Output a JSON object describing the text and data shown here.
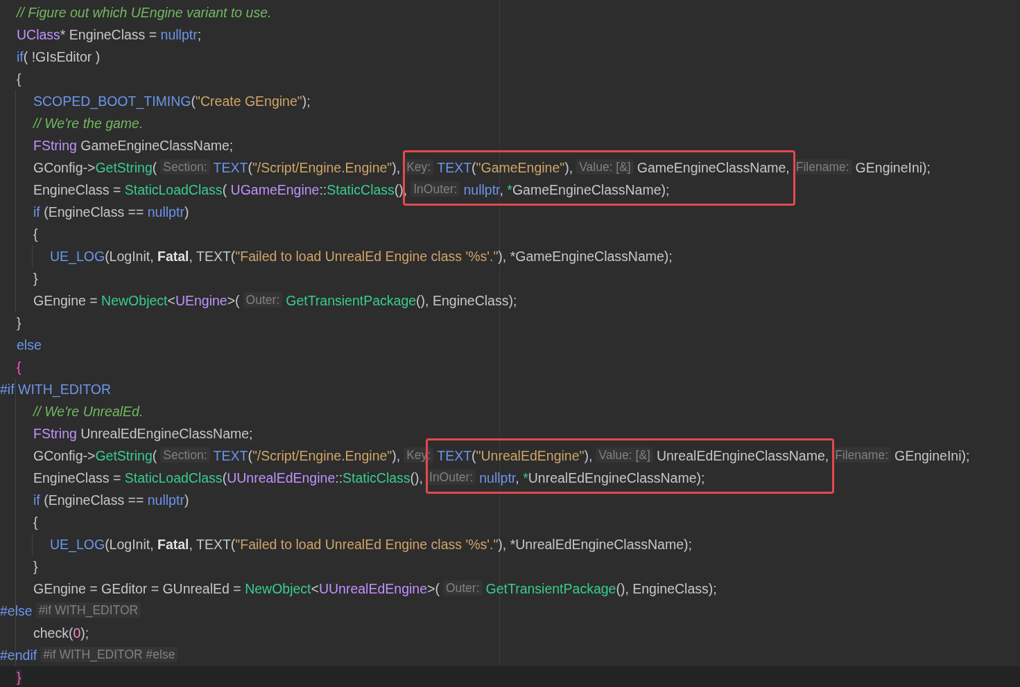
{
  "editor": {
    "lines": [
      {
        "tokens": [
          {
            "kind": "comment",
            "text": "// Figure out which UEngine variant to use."
          }
        ]
      },
      {
        "tokens": [
          {
            "kind": "type",
            "text": "UClass"
          },
          {
            "kind": "plain",
            "text": "* EngineClass = "
          },
          {
            "kind": "keyword",
            "text": "nullptr"
          },
          {
            "kind": "plain",
            "text": ";"
          }
        ]
      },
      {
        "tokens": [
          {
            "kind": "keyword",
            "text": "if"
          },
          {
            "kind": "plain",
            "text": "( !GIsEditor )"
          }
        ]
      },
      {
        "tokens": [
          {
            "kind": "plain",
            "text": "{"
          }
        ],
        "children": [
          {
            "tokens": [
              {
                "kind": "macro",
                "text": "SCOPED_BOOT_TIMING"
              },
              {
                "kind": "plain",
                "text": "("
              },
              {
                "kind": "string",
                "text": "\"Create GEngine\""
              },
              {
                "kind": "plain",
                "text": ");"
              }
            ]
          },
          {
            "tokens": [
              {
                "kind": "comment",
                "text": "// We're the game."
              }
            ]
          },
          {
            "tokens": [
              {
                "kind": "type",
                "text": "FString"
              },
              {
                "kind": "plain",
                "text": " GameEngineClassName;"
              }
            ]
          },
          {
            "tokens": [
              {
                "kind": "plain",
                "text": "GConfig->"
              },
              {
                "kind": "function",
                "text": "GetString"
              },
              {
                "kind": "plain",
                "text": "("
              },
              {
                "kind": "hint",
                "text": "Section:"
              },
              {
                "kind": "macro",
                "text": "TEXT"
              },
              {
                "kind": "plain",
                "text": "("
              },
              {
                "kind": "string",
                "text": "\"/Script/Engine.Engine\""
              },
              {
                "kind": "plain",
                "text": "),"
              },
              {
                "kind": "hint",
                "text": "Key:",
                "boxed": true
              },
              {
                "kind": "macro",
                "text": "TEXT",
                "boxed": true
              },
              {
                "kind": "plain",
                "text": "(",
                "boxed": true
              },
              {
                "kind": "string",
                "text": "\"GameEngine\"",
                "boxed": true
              },
              {
                "kind": "plain",
                "text": "),",
                "boxed": true
              },
              {
                "kind": "hint",
                "text": "Value: [&]",
                "boxed": true
              },
              {
                "kind": "plain",
                "text": "GameEngineClassName,",
                "boxed": true
              },
              {
                "kind": "hint",
                "text": "Filename:"
              },
              {
                "kind": "plain",
                "text": "GEngineIni);"
              }
            ]
          },
          {
            "tokens": [
              {
                "kind": "plain",
                "text": "EngineClass = "
              },
              {
                "kind": "function",
                "text": "StaticLoadClass"
              },
              {
                "kind": "plain",
                "text": "( "
              },
              {
                "kind": "type",
                "text": "UGameEngine"
              },
              {
                "kind": "plain",
                "text": "::"
              },
              {
                "kind": "function",
                "text": "StaticClass"
              },
              {
                "kind": "plain",
                "text": "(),"
              },
              {
                "kind": "hint",
                "text": "InOuter:"
              },
              {
                "kind": "keyword",
                "text": "nullptr",
                "boxed": true
              },
              {
                "kind": "plain",
                "text": ", ",
                "boxed": true
              },
              {
                "kind": "deref",
                "text": "*",
                "boxed": true
              },
              {
                "kind": "plain",
                "text": "GameEngineClassName);",
                "boxed": true
              }
            ]
          },
          {
            "tokens": [
              {
                "kind": "keyword",
                "text": "if"
              },
              {
                "kind": "plain",
                "text": " (EngineClass == "
              },
              {
                "kind": "keyword",
                "text": "nullptr"
              },
              {
                "kind": "plain",
                "text": ")"
              }
            ]
          },
          {
            "tokens": [
              {
                "kind": "plain",
                "text": "{"
              }
            ],
            "children": [
              {
                "tokens": [
                  {
                    "kind": "macro",
                    "text": "UE_LOG"
                  },
                  {
                    "kind": "plain",
                    "text": "(LogInit, "
                  },
                  {
                    "kind": "enum",
                    "text": "Fatal"
                  },
                  {
                    "kind": "plain",
                    "text": ", TEXT("
                  },
                  {
                    "kind": "string",
                    "text": "\"Failed to load UnrealEd Engine class '%s'.\""
                  },
                  {
                    "kind": "plain",
                    "text": "), *GameEngineClassName);"
                  }
                ]
              }
            ]
          },
          {
            "tokens": [
              {
                "kind": "plain",
                "text": "}"
              }
            ]
          },
          {
            "tokens": [
              {
                "kind": "plain",
                "text": "GEngine = "
              },
              {
                "kind": "function",
                "text": "NewObject"
              },
              {
                "kind": "plain",
                "text": "<"
              },
              {
                "kind": "type",
                "text": "UEngine"
              },
              {
                "kind": "plain",
                "text": ">("
              },
              {
                "kind": "hint",
                "text": "Outer:"
              },
              {
                "kind": "function",
                "text": "GetTransientPackage"
              },
              {
                "kind": "plain",
                "text": "(), EngineClass);"
              }
            ]
          }
        ]
      },
      {
        "tokens": [
          {
            "kind": "plain",
            "text": "}"
          }
        ]
      },
      {
        "tokens": [
          {
            "kind": "keyword",
            "text": "else"
          }
        ]
      },
      {
        "tokens": [
          {
            "kind": "matched-brace",
            "text": "{"
          }
        ],
        "children": [
          {
            "kind": "directive",
            "tokens": [
              {
                "kind": "macro",
                "text": "#if WITH_EDITOR"
              }
            ]
          },
          {
            "tokens": [
              {
                "kind": "comment",
                "text": "// We're UnrealEd."
              }
            ]
          },
          {
            "tokens": [
              {
                "kind": "type",
                "text": "FString"
              },
              {
                "kind": "plain",
                "text": " UnrealEdEngineClassName;"
              }
            ]
          },
          {
            "tokens": [
              {
                "kind": "plain",
                "text": "GConfig->"
              },
              {
                "kind": "function",
                "text": "GetString"
              },
              {
                "kind": "plain",
                "text": "("
              },
              {
                "kind": "hint",
                "text": "Section:"
              },
              {
                "kind": "macro",
                "text": "TEXT"
              },
              {
                "kind": "plain",
                "text": "("
              },
              {
                "kind": "string",
                "text": "\"/Script/Engine.Engine\""
              },
              {
                "kind": "plain",
                "text": "),"
              },
              {
                "kind": "hint",
                "text": "Key:"
              },
              {
                "kind": "macro",
                "text": "TEXT",
                "boxed": true
              },
              {
                "kind": "plain",
                "text": "(",
                "boxed": true
              },
              {
                "kind": "string",
                "text": "\"UnrealEdEngine\"",
                "boxed": true
              },
              {
                "kind": "plain",
                "text": "),",
                "boxed": true
              },
              {
                "kind": "hint",
                "text": "Value: [&]",
                "boxed": true
              },
              {
                "kind": "plain",
                "text": "UnrealEdEngineClassName,",
                "boxed": true
              },
              {
                "kind": "hint",
                "text": "Filename:"
              },
              {
                "kind": "plain",
                "text": "GEngineIni);"
              }
            ]
          },
          {
            "tokens": [
              {
                "kind": "plain",
                "text": "EngineClass = "
              },
              {
                "kind": "function",
                "text": "StaticLoadClass"
              },
              {
                "kind": "plain",
                "text": "("
              },
              {
                "kind": "type",
                "text": "UUnrealEdEngine"
              },
              {
                "kind": "plain",
                "text": "::"
              },
              {
                "kind": "function",
                "text": "StaticClass"
              },
              {
                "kind": "plain",
                "text": "(),"
              },
              {
                "kind": "hint",
                "text": "InOuter:",
                "boxed": true
              },
              {
                "kind": "keyword",
                "text": "nullptr",
                "boxed": true
              },
              {
                "kind": "plain",
                "text": ", ",
                "boxed": true
              },
              {
                "kind": "deref",
                "text": "*",
                "boxed": true
              },
              {
                "kind": "plain",
                "text": "UnrealEdEngineClassName);",
                "boxed": true
              }
            ]
          },
          {
            "tokens": [
              {
                "kind": "keyword",
                "text": "if"
              },
              {
                "kind": "plain",
                "text": " (EngineClass == "
              },
              {
                "kind": "keyword",
                "text": "nullptr"
              },
              {
                "kind": "plain",
                "text": ")"
              }
            ]
          },
          {
            "tokens": [
              {
                "kind": "plain",
                "text": "{"
              }
            ],
            "children": [
              {
                "tokens": [
                  {
                    "kind": "macro",
                    "text": "UE_LOG"
                  },
                  {
                    "kind": "plain",
                    "text": "(LogInit, "
                  },
                  {
                    "kind": "enum",
                    "text": "Fatal"
                  },
                  {
                    "kind": "plain",
                    "text": ", TEXT("
                  },
                  {
                    "kind": "string",
                    "text": "\"Failed to load UnrealEd Engine class '%s'.\""
                  },
                  {
                    "kind": "plain",
                    "text": "), *UnrealEdEngineClassName);"
                  }
                ]
              }
            ]
          },
          {
            "tokens": [
              {
                "kind": "plain",
                "text": "}"
              }
            ]
          },
          {
            "tokens": [
              {
                "kind": "plain",
                "text": "GEngine = GEditor = GUnrealEd = "
              },
              {
                "kind": "function",
                "text": "NewObject"
              },
              {
                "kind": "plain",
                "text": "<"
              },
              {
                "kind": "type",
                "text": "UUnrealEdEngine"
              },
              {
                "kind": "plain",
                "text": ">("
              },
              {
                "kind": "hint",
                "text": "Outer:"
              },
              {
                "kind": "function",
                "text": "GetTransientPackage"
              },
              {
                "kind": "plain",
                "text": "(), EngineClass);"
              }
            ]
          },
          {
            "kind": "directive",
            "tokens": [
              {
                "kind": "macro",
                "text": "#else"
              },
              {
                "kind": "hint",
                "text": "#if WITH_EDITOR"
              }
            ]
          },
          {
            "tokens": [
              {
                "kind": "plain",
                "text": "check("
              },
              {
                "kind": "number",
                "text": "0"
              },
              {
                "kind": "plain",
                "text": ");"
              }
            ]
          },
          {
            "kind": "directive",
            "tokens": [
              {
                "kind": "macro",
                "text": "#endif"
              },
              {
                "kind": "hint",
                "text": "#if WITH_EDITOR #else"
              }
            ]
          }
        ]
      },
      {
        "current": true,
        "tokens": [
          {
            "kind": "matched-brace",
            "text": "}"
          }
        ]
      }
    ]
  }
}
